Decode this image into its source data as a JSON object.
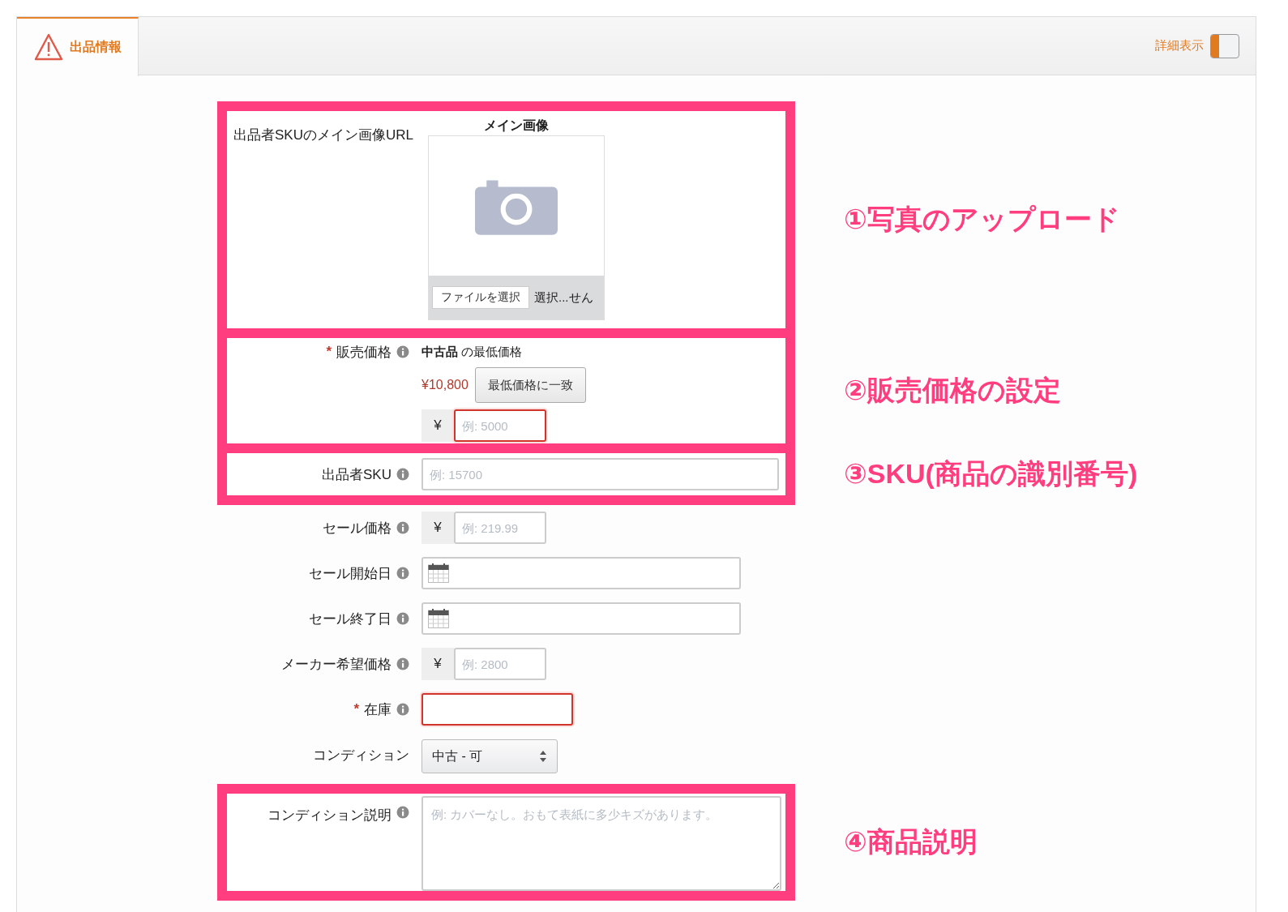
{
  "tabs": [
    {
      "label": "出品情報",
      "selected": true
    }
  ],
  "detail_toggle": {
    "label": "詳細表示",
    "on": false
  },
  "sections": [
    {
      "annotation": "①写真のアップロード",
      "fields": [
        {
          "kind": "image",
          "label": "出品者SKUのメイン画像URL",
          "title": "メイン画像",
          "button": "ファイルを選択",
          "file_status": "選択...せん"
        }
      ]
    },
    {
      "annotation": "②販売価格の設定",
      "fields": [
        {
          "kind": "price_block",
          "required_mark": "*",
          "label": "販売価格",
          "info": true,
          "lowest_label": "**中古品** の最低価格",
          "lowest_price": "¥10,800",
          "match_button": "最低価格に一致",
          "currency": "¥",
          "placeholder": "例: 5000",
          "error": true
        }
      ]
    },
    {
      "annotation": "③SKU(商品の識別番号)",
      "fields": [
        {
          "kind": "text",
          "label": "出品者SKU",
          "info": true,
          "placeholder": "例: 15700",
          "error": false
        }
      ]
    },
    {
      "fields": [
        {
          "kind": "price",
          "label": "セール価格",
          "info": true,
          "currency": "¥",
          "placeholder": "例: 219.99",
          "error": false
        },
        {
          "kind": "date",
          "label": "セール開始日",
          "info": true,
          "error": false
        },
        {
          "kind": "date",
          "label": "セール終了日",
          "info": true,
          "error": false
        },
        {
          "kind": "price",
          "label": "メーカー希望価格",
          "info": true,
          "currency": "¥",
          "placeholder": "例: 2800",
          "error": false
        },
        {
          "kind": "number",
          "required_mark": "*",
          "label": "在庫",
          "info": true,
          "error": true
        },
        {
          "kind": "select",
          "label": "コンディション",
          "info": false,
          "value": "中古 - 可"
        }
      ]
    },
    {
      "annotation": "④商品説明",
      "fields": [
        {
          "kind": "textarea",
          "label": "コンディション説明",
          "info": true,
          "placeholder": "例: カバーなし。おもて表紙に多少キズがあります。",
          "error": false
        }
      ]
    }
  ]
}
